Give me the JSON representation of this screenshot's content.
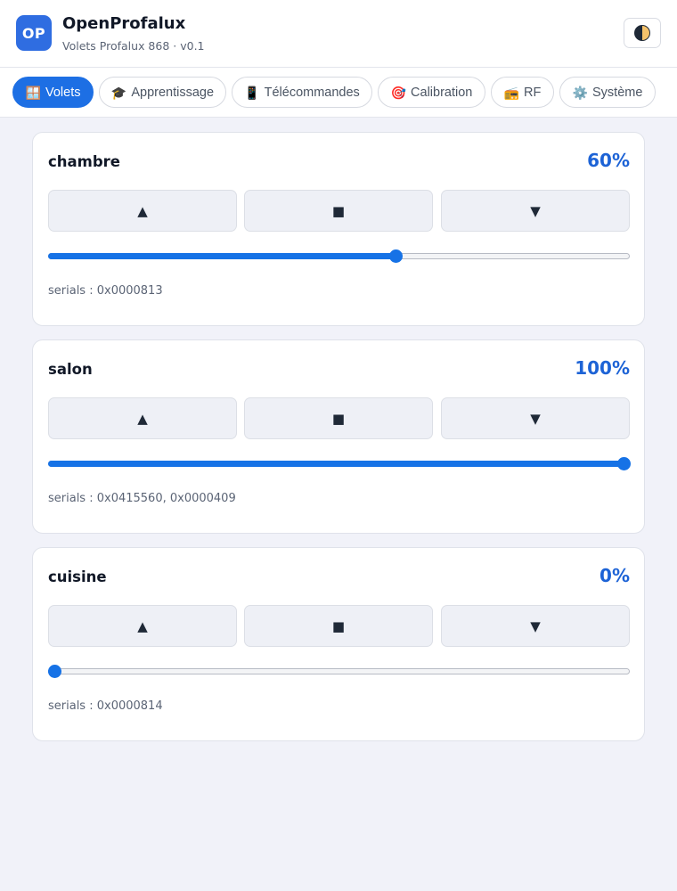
{
  "header": {
    "logo_text": "OP",
    "title": "OpenProfalux",
    "subtitle": "Volets Profalux 868 · v0.1",
    "theme_icon": "contrast-icon"
  },
  "tabs": [
    {
      "icon": "🪟",
      "label": "Volets",
      "active": true
    },
    {
      "icon": "🎓",
      "label": "Apprentissage",
      "active": false
    },
    {
      "icon": "📱",
      "label": "Télécommandes",
      "active": false
    },
    {
      "icon": "🎯",
      "label": "Calibration",
      "active": false
    },
    {
      "icon": "📻",
      "label": "RF",
      "active": false
    },
    {
      "icon": "⚙️",
      "label": "Système",
      "active": false
    }
  ],
  "controls": {
    "up": "▲",
    "stop": "■",
    "down": "▼"
  },
  "shutters": [
    {
      "name": "chambre",
      "percent_label": "60%",
      "position": 60,
      "serials": "serials : 0x0000813"
    },
    {
      "name": "salon",
      "percent_label": "100%",
      "position": 100,
      "serials": "serials : 0x0415560, 0x0000409"
    },
    {
      "name": "cuisine",
      "percent_label": "0%",
      "position": 0,
      "serials": "serials : 0x0000814"
    }
  ],
  "colors": {
    "accent": "#1d6fe4",
    "percent_text": "#1d63d6",
    "slider": "#1672e6"
  }
}
